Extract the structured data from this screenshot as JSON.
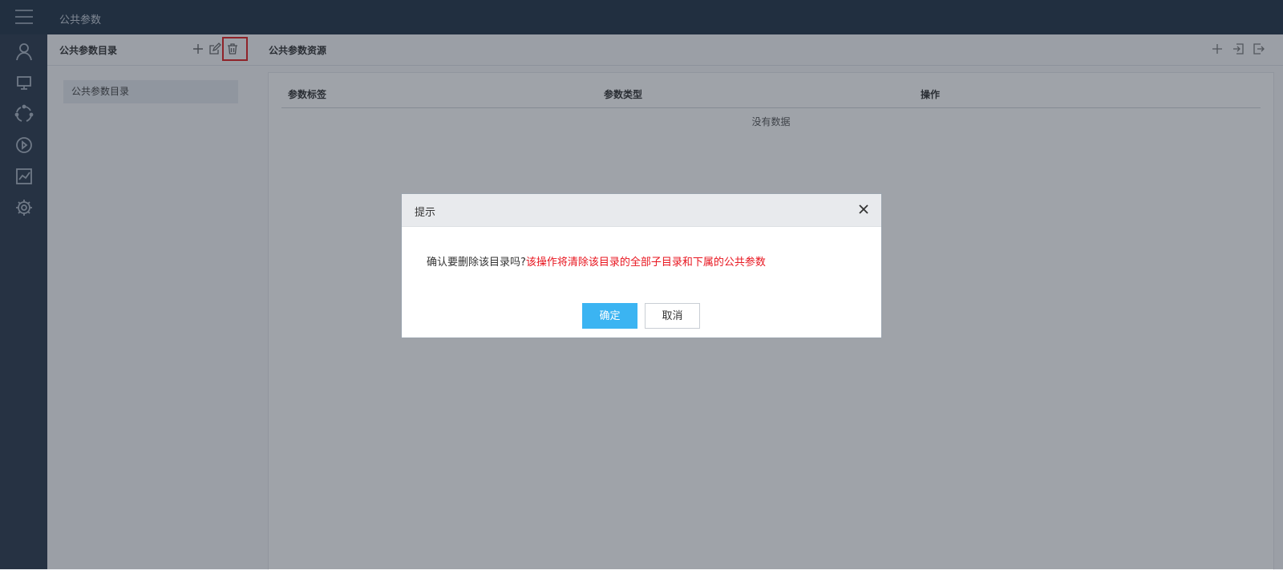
{
  "topbar": {
    "title": "公共参数",
    "menu_icon": "hamburger-icon"
  },
  "sidebar": {
    "items": [
      {
        "icon": "user-icon"
      },
      {
        "icon": "monitor-icon"
      },
      {
        "icon": "refresh-cycle-icon"
      },
      {
        "icon": "play-icon"
      },
      {
        "icon": "chart-icon"
      },
      {
        "icon": "gear-icon"
      }
    ]
  },
  "left_panel": {
    "title": "公共参数目录",
    "tools": [
      "add-icon",
      "edit-icon",
      "trash-icon"
    ],
    "tree": [
      {
        "label": "公共参数目录"
      }
    ]
  },
  "right_panel": {
    "title": "公共参数资源",
    "tools": [
      "add-icon",
      "import-icon",
      "export-icon"
    ],
    "table": {
      "columns": [
        "参数标签",
        "参数类型",
        "操作"
      ],
      "empty_text": "没有数据"
    }
  },
  "dialog": {
    "title": "提示",
    "message": "确认要删除该目录吗?",
    "warning": "该操作将清除该目录的全部子目录和下属的公共参数",
    "ok_label": "确定",
    "cancel_label": "取消"
  },
  "colors": {
    "topbar": "#243447",
    "sidebar": "#2b3a4d",
    "primary_button": "#3bb4f2",
    "warning_text": "#e8141e",
    "highlight": "#e02020"
  }
}
